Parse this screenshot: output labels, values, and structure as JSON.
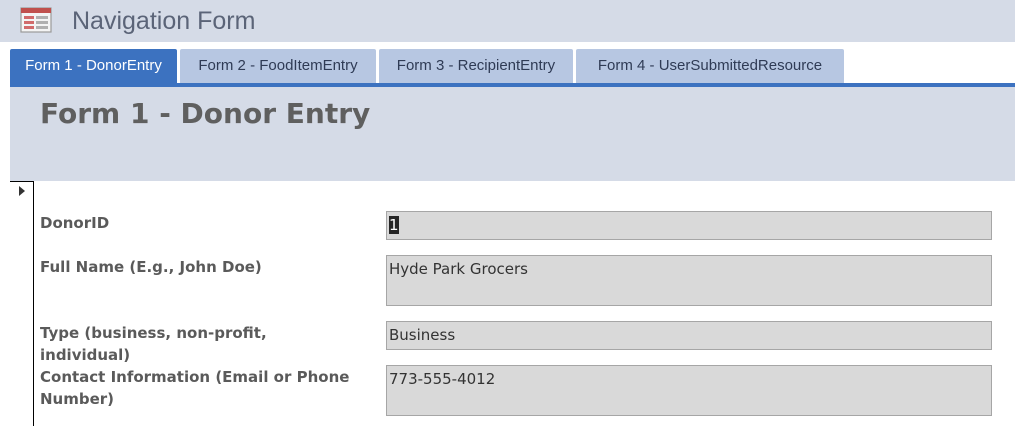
{
  "window": {
    "title": "Navigation Form",
    "icon": "navigation-form-icon"
  },
  "tabs": [
    {
      "label": "Form 1 - DonorEntry",
      "active": true
    },
    {
      "label": "Form 2 - FoodItemEntry",
      "active": false
    },
    {
      "label": "Form 3 - RecipientEntry",
      "active": false
    },
    {
      "label": "Form 4 - UserSubmittedResource",
      "active": false
    }
  ],
  "form": {
    "title": "Form 1 - Donor Entry",
    "fields": [
      {
        "label": "DonorID",
        "value": "1"
      },
      {
        "label": "Full Name (E.g., John Doe)",
        "value": "Hyde Park Grocers"
      },
      {
        "label": "Type (business, non-profit, individual)",
        "value": "Business"
      },
      {
        "label": "Contact Information (Email or Phone Number)",
        "value": "773-555-4012"
      }
    ]
  },
  "colors": {
    "header_bg": "#d5dbe7",
    "tab_inactive": "#b7c7e2",
    "tab_active": "#3c72c0",
    "field_bg": "#d9d9d9"
  }
}
